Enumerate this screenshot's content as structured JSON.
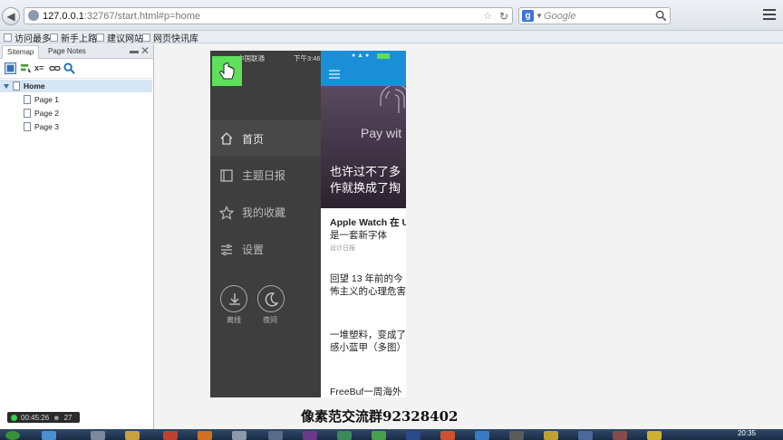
{
  "browser": {
    "url_host": "127.0.0.1",
    "url_rest": ":32767/start.html#p=home",
    "search_placeholder": "Google",
    "bookmarks": [
      "访问最多",
      "新手上路",
      "建议网站",
      "网页快讯库"
    ]
  },
  "sidebar": {
    "tabs": [
      "Sitemap",
      "Page Notes"
    ],
    "tree": {
      "root": "Home",
      "children": [
        "Page 1",
        "Page 2",
        "Page 3"
      ]
    }
  },
  "status_pill": {
    "time": "00:45:26",
    "count": "27"
  },
  "phone": {
    "carrier": "中国联通",
    "time": "下午3:46",
    "menu": {
      "items": [
        {
          "label": "首页",
          "icon": "home-icon"
        },
        {
          "label": "主题日报",
          "icon": "book-icon"
        },
        {
          "label": "我的收藏",
          "icon": "star-icon"
        },
        {
          "label": "设置",
          "icon": "settings-icon"
        }
      ],
      "offline_label": "离线",
      "night_label": "夜间"
    },
    "hero": {
      "pay_text": "Pay wit",
      "line1": "也许过不了多",
      "line2": "作就换成了掏"
    },
    "news": [
      {
        "line1": "Apple Watch 在 U",
        "line2": "是一套新字体",
        "sub": "设计日报"
      },
      {
        "line1": "回望 13 年前的今",
        "line2": "怖主义的心理危害"
      },
      {
        "line1": "一堆塑料，变成了",
        "line2": "感小蓝甲（多图）"
      },
      {
        "line1": "FreeBuf一周海外"
      }
    ]
  },
  "watermark": "像素范交流群92328402",
  "clock": "20:35",
  "colors": {
    "app_blue": "#1a8fd7",
    "menu_dark": "#3e3e3e",
    "green_button": "#5de05a"
  }
}
